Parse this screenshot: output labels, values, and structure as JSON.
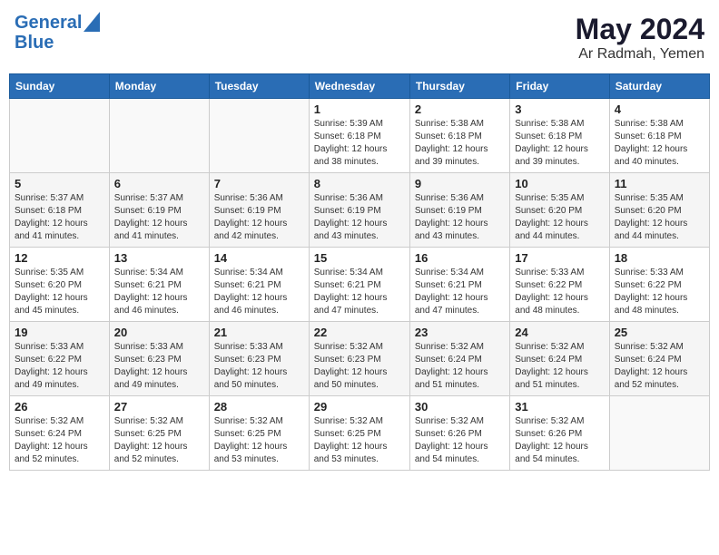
{
  "header": {
    "logo_line1": "General",
    "logo_line2": "Blue",
    "month_year": "May 2024",
    "location": "Ar Radmah, Yemen"
  },
  "days_of_week": [
    "Sunday",
    "Monday",
    "Tuesday",
    "Wednesday",
    "Thursday",
    "Friday",
    "Saturday"
  ],
  "weeks": [
    [
      {
        "day": "",
        "info": ""
      },
      {
        "day": "",
        "info": ""
      },
      {
        "day": "",
        "info": ""
      },
      {
        "day": "1",
        "info": "Sunrise: 5:39 AM\nSunset: 6:18 PM\nDaylight: 12 hours\nand 38 minutes."
      },
      {
        "day": "2",
        "info": "Sunrise: 5:38 AM\nSunset: 6:18 PM\nDaylight: 12 hours\nand 39 minutes."
      },
      {
        "day": "3",
        "info": "Sunrise: 5:38 AM\nSunset: 6:18 PM\nDaylight: 12 hours\nand 39 minutes."
      },
      {
        "day": "4",
        "info": "Sunrise: 5:38 AM\nSunset: 6:18 PM\nDaylight: 12 hours\nand 40 minutes."
      }
    ],
    [
      {
        "day": "5",
        "info": "Sunrise: 5:37 AM\nSunset: 6:18 PM\nDaylight: 12 hours\nand 41 minutes."
      },
      {
        "day": "6",
        "info": "Sunrise: 5:37 AM\nSunset: 6:19 PM\nDaylight: 12 hours\nand 41 minutes."
      },
      {
        "day": "7",
        "info": "Sunrise: 5:36 AM\nSunset: 6:19 PM\nDaylight: 12 hours\nand 42 minutes."
      },
      {
        "day": "8",
        "info": "Sunrise: 5:36 AM\nSunset: 6:19 PM\nDaylight: 12 hours\nand 43 minutes."
      },
      {
        "day": "9",
        "info": "Sunrise: 5:36 AM\nSunset: 6:19 PM\nDaylight: 12 hours\nand 43 minutes."
      },
      {
        "day": "10",
        "info": "Sunrise: 5:35 AM\nSunset: 6:20 PM\nDaylight: 12 hours\nand 44 minutes."
      },
      {
        "day": "11",
        "info": "Sunrise: 5:35 AM\nSunset: 6:20 PM\nDaylight: 12 hours\nand 44 minutes."
      }
    ],
    [
      {
        "day": "12",
        "info": "Sunrise: 5:35 AM\nSunset: 6:20 PM\nDaylight: 12 hours\nand 45 minutes."
      },
      {
        "day": "13",
        "info": "Sunrise: 5:34 AM\nSunset: 6:21 PM\nDaylight: 12 hours\nand 46 minutes."
      },
      {
        "day": "14",
        "info": "Sunrise: 5:34 AM\nSunset: 6:21 PM\nDaylight: 12 hours\nand 46 minutes."
      },
      {
        "day": "15",
        "info": "Sunrise: 5:34 AM\nSunset: 6:21 PM\nDaylight: 12 hours\nand 47 minutes."
      },
      {
        "day": "16",
        "info": "Sunrise: 5:34 AM\nSunset: 6:21 PM\nDaylight: 12 hours\nand 47 minutes."
      },
      {
        "day": "17",
        "info": "Sunrise: 5:33 AM\nSunset: 6:22 PM\nDaylight: 12 hours\nand 48 minutes."
      },
      {
        "day": "18",
        "info": "Sunrise: 5:33 AM\nSunset: 6:22 PM\nDaylight: 12 hours\nand 48 minutes."
      }
    ],
    [
      {
        "day": "19",
        "info": "Sunrise: 5:33 AM\nSunset: 6:22 PM\nDaylight: 12 hours\nand 49 minutes."
      },
      {
        "day": "20",
        "info": "Sunrise: 5:33 AM\nSunset: 6:23 PM\nDaylight: 12 hours\nand 49 minutes."
      },
      {
        "day": "21",
        "info": "Sunrise: 5:33 AM\nSunset: 6:23 PM\nDaylight: 12 hours\nand 50 minutes."
      },
      {
        "day": "22",
        "info": "Sunrise: 5:32 AM\nSunset: 6:23 PM\nDaylight: 12 hours\nand 50 minutes."
      },
      {
        "day": "23",
        "info": "Sunrise: 5:32 AM\nSunset: 6:24 PM\nDaylight: 12 hours\nand 51 minutes."
      },
      {
        "day": "24",
        "info": "Sunrise: 5:32 AM\nSunset: 6:24 PM\nDaylight: 12 hours\nand 51 minutes."
      },
      {
        "day": "25",
        "info": "Sunrise: 5:32 AM\nSunset: 6:24 PM\nDaylight: 12 hours\nand 52 minutes."
      }
    ],
    [
      {
        "day": "26",
        "info": "Sunrise: 5:32 AM\nSunset: 6:24 PM\nDaylight: 12 hours\nand 52 minutes."
      },
      {
        "day": "27",
        "info": "Sunrise: 5:32 AM\nSunset: 6:25 PM\nDaylight: 12 hours\nand 52 minutes."
      },
      {
        "day": "28",
        "info": "Sunrise: 5:32 AM\nSunset: 6:25 PM\nDaylight: 12 hours\nand 53 minutes."
      },
      {
        "day": "29",
        "info": "Sunrise: 5:32 AM\nSunset: 6:25 PM\nDaylight: 12 hours\nand 53 minutes."
      },
      {
        "day": "30",
        "info": "Sunrise: 5:32 AM\nSunset: 6:26 PM\nDaylight: 12 hours\nand 54 minutes."
      },
      {
        "day": "31",
        "info": "Sunrise: 5:32 AM\nSunset: 6:26 PM\nDaylight: 12 hours\nand 54 minutes."
      },
      {
        "day": "",
        "info": ""
      }
    ]
  ]
}
